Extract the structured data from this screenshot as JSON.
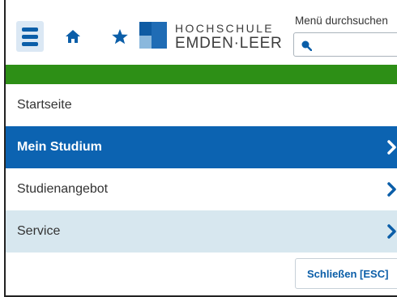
{
  "header": {
    "menu_icon": "hamburger-menu-icon",
    "home_icon": "home-icon",
    "star_icon": "star-icon",
    "logo": {
      "line1": "HOCHSCHULE",
      "line2": "EMDEN·LEER"
    },
    "search": {
      "label": "Menü durchsuchen",
      "value": "",
      "icon": "search-icon"
    }
  },
  "colors": {
    "accent_bar": "#2d8f16",
    "active_item_bg": "#0c63b1",
    "tinted_item_bg": "#d7e7ef",
    "chevron": "#0b5ea8"
  },
  "nav": {
    "items": [
      {
        "label": "Startseite",
        "has_submenu": false,
        "state": "plain"
      },
      {
        "label": "Mein Studium",
        "has_submenu": true,
        "state": "active"
      },
      {
        "label": "Studienangebot",
        "has_submenu": true,
        "state": "plain"
      },
      {
        "label": "Service",
        "has_submenu": true,
        "state": "tinted"
      }
    ]
  },
  "footer": {
    "close_label": "Schließen [ESC]"
  }
}
